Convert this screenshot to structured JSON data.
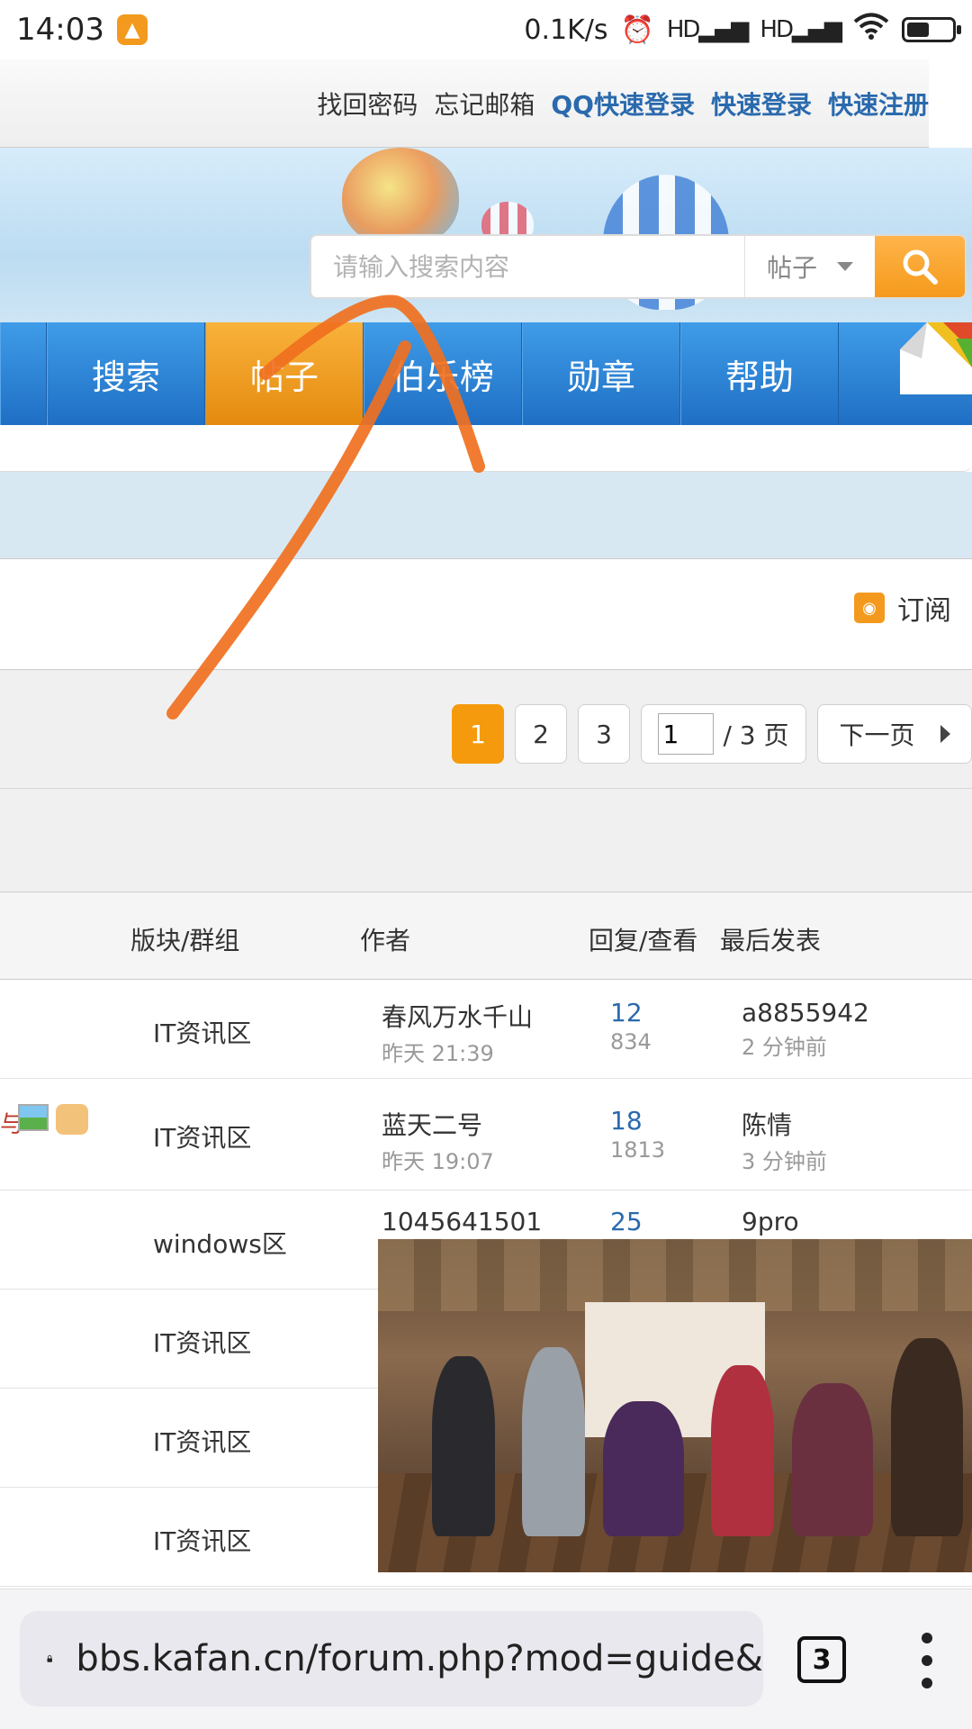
{
  "status": {
    "time": "14:03",
    "speed": "0.1K/s",
    "signal1": "HD",
    "signal2": "HD",
    "battery_level": 0.45
  },
  "toplinks": {
    "recover_password": "找回密码",
    "forgot_email": "忘记邮箱",
    "qq_login": "QQ快速登录",
    "quick_login": "快速登录",
    "quick_register": "快速注册"
  },
  "search": {
    "placeholder": "请输入搜索内容",
    "type": "帖子"
  },
  "nav": {
    "items": [
      "搜索",
      "帖子",
      "伯乐榜",
      "勋章",
      "帮助"
    ],
    "active": "帖子"
  },
  "subscribe": {
    "label": "订阅"
  },
  "pager": {
    "pages": [
      "1",
      "2",
      "3"
    ],
    "current": "1",
    "jump_value": "1",
    "total": "/ 3 页",
    "next": "下一页"
  },
  "table": {
    "headers": {
      "forum": "版块/群组",
      "author": "作者",
      "stats": "回复/查看",
      "last": "最后发表"
    },
    "rows": [
      {
        "forum": "IT资讯区",
        "author": "春风万水千山",
        "author_time": "昨天 21:39",
        "replies": "12",
        "views": "834",
        "last_user": "a8855942",
        "last_time": "2 分钟前"
      },
      {
        "forum": "IT资讯区",
        "author": "蓝天二号",
        "author_time": "昨天 19:07",
        "replies": "18",
        "views": "1813",
        "last_user": "陈情",
        "last_time": "3 分钟前",
        "edge_text": "与"
      },
      {
        "forum": "windows区",
        "author": "1045641501",
        "replies": "25",
        "last_user": "9pro"
      },
      {
        "forum": "IT资讯区"
      },
      {
        "forum": "IT资讯区"
      },
      {
        "forum": "IT资讯区"
      }
    ]
  },
  "browser": {
    "url": "bbs.kafan.cn/forum.php?mod=guide&",
    "tab_count": "3"
  },
  "colors": {
    "nav_blue": "#2a84d8",
    "nav_active": "#f5a01f",
    "link_blue": "#2a6aad",
    "gesture": "#f07020"
  }
}
